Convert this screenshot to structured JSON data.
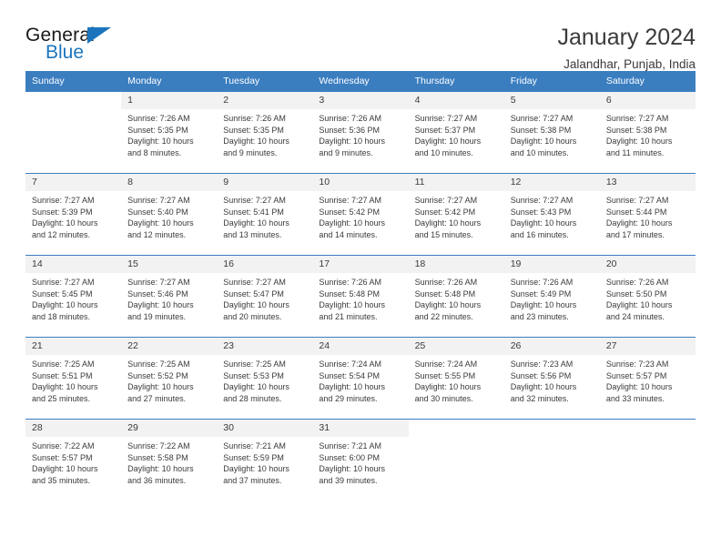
{
  "brand": {
    "name_part1": "General",
    "name_part2": "Blue",
    "logo_icon": "triangle-flag-icon"
  },
  "header": {
    "title": "January 2024",
    "subtitle": "Jalandhar, Punjab, India"
  },
  "colors": {
    "header_blue": "#3b7ec0",
    "brand_blue": "#1c75bc",
    "daynum_band": "#f2f2f2",
    "text": "#3a3a3a"
  },
  "weekday_headers": [
    "Sunday",
    "Monday",
    "Tuesday",
    "Wednesday",
    "Thursday",
    "Friday",
    "Saturday"
  ],
  "weeks": [
    [
      {
        "day": "",
        "sunrise": "",
        "sunset": "",
        "daylight1": "",
        "daylight2": ""
      },
      {
        "day": "1",
        "sunrise": "Sunrise: 7:26 AM",
        "sunset": "Sunset: 5:35 PM",
        "daylight1": "Daylight: 10 hours",
        "daylight2": "and 8 minutes."
      },
      {
        "day": "2",
        "sunrise": "Sunrise: 7:26 AM",
        "sunset": "Sunset: 5:35 PM",
        "daylight1": "Daylight: 10 hours",
        "daylight2": "and 9 minutes."
      },
      {
        "day": "3",
        "sunrise": "Sunrise: 7:26 AM",
        "sunset": "Sunset: 5:36 PM",
        "daylight1": "Daylight: 10 hours",
        "daylight2": "and 9 minutes."
      },
      {
        "day": "4",
        "sunrise": "Sunrise: 7:27 AM",
        "sunset": "Sunset: 5:37 PM",
        "daylight1": "Daylight: 10 hours",
        "daylight2": "and 10 minutes."
      },
      {
        "day": "5",
        "sunrise": "Sunrise: 7:27 AM",
        "sunset": "Sunset: 5:38 PM",
        "daylight1": "Daylight: 10 hours",
        "daylight2": "and 10 minutes."
      },
      {
        "day": "6",
        "sunrise": "Sunrise: 7:27 AM",
        "sunset": "Sunset: 5:38 PM",
        "daylight1": "Daylight: 10 hours",
        "daylight2": "and 11 minutes."
      }
    ],
    [
      {
        "day": "7",
        "sunrise": "Sunrise: 7:27 AM",
        "sunset": "Sunset: 5:39 PM",
        "daylight1": "Daylight: 10 hours",
        "daylight2": "and 12 minutes."
      },
      {
        "day": "8",
        "sunrise": "Sunrise: 7:27 AM",
        "sunset": "Sunset: 5:40 PM",
        "daylight1": "Daylight: 10 hours",
        "daylight2": "and 12 minutes."
      },
      {
        "day": "9",
        "sunrise": "Sunrise: 7:27 AM",
        "sunset": "Sunset: 5:41 PM",
        "daylight1": "Daylight: 10 hours",
        "daylight2": "and 13 minutes."
      },
      {
        "day": "10",
        "sunrise": "Sunrise: 7:27 AM",
        "sunset": "Sunset: 5:42 PM",
        "daylight1": "Daylight: 10 hours",
        "daylight2": "and 14 minutes."
      },
      {
        "day": "11",
        "sunrise": "Sunrise: 7:27 AM",
        "sunset": "Sunset: 5:42 PM",
        "daylight1": "Daylight: 10 hours",
        "daylight2": "and 15 minutes."
      },
      {
        "day": "12",
        "sunrise": "Sunrise: 7:27 AM",
        "sunset": "Sunset: 5:43 PM",
        "daylight1": "Daylight: 10 hours",
        "daylight2": "and 16 minutes."
      },
      {
        "day": "13",
        "sunrise": "Sunrise: 7:27 AM",
        "sunset": "Sunset: 5:44 PM",
        "daylight1": "Daylight: 10 hours",
        "daylight2": "and 17 minutes."
      }
    ],
    [
      {
        "day": "14",
        "sunrise": "Sunrise: 7:27 AM",
        "sunset": "Sunset: 5:45 PM",
        "daylight1": "Daylight: 10 hours",
        "daylight2": "and 18 minutes."
      },
      {
        "day": "15",
        "sunrise": "Sunrise: 7:27 AM",
        "sunset": "Sunset: 5:46 PM",
        "daylight1": "Daylight: 10 hours",
        "daylight2": "and 19 minutes."
      },
      {
        "day": "16",
        "sunrise": "Sunrise: 7:27 AM",
        "sunset": "Sunset: 5:47 PM",
        "daylight1": "Daylight: 10 hours",
        "daylight2": "and 20 minutes."
      },
      {
        "day": "17",
        "sunrise": "Sunrise: 7:26 AM",
        "sunset": "Sunset: 5:48 PM",
        "daylight1": "Daylight: 10 hours",
        "daylight2": "and 21 minutes."
      },
      {
        "day": "18",
        "sunrise": "Sunrise: 7:26 AM",
        "sunset": "Sunset: 5:48 PM",
        "daylight1": "Daylight: 10 hours",
        "daylight2": "and 22 minutes."
      },
      {
        "day": "19",
        "sunrise": "Sunrise: 7:26 AM",
        "sunset": "Sunset: 5:49 PM",
        "daylight1": "Daylight: 10 hours",
        "daylight2": "and 23 minutes."
      },
      {
        "day": "20",
        "sunrise": "Sunrise: 7:26 AM",
        "sunset": "Sunset: 5:50 PM",
        "daylight1": "Daylight: 10 hours",
        "daylight2": "and 24 minutes."
      }
    ],
    [
      {
        "day": "21",
        "sunrise": "Sunrise: 7:25 AM",
        "sunset": "Sunset: 5:51 PM",
        "daylight1": "Daylight: 10 hours",
        "daylight2": "and 25 minutes."
      },
      {
        "day": "22",
        "sunrise": "Sunrise: 7:25 AM",
        "sunset": "Sunset: 5:52 PM",
        "daylight1": "Daylight: 10 hours",
        "daylight2": "and 27 minutes."
      },
      {
        "day": "23",
        "sunrise": "Sunrise: 7:25 AM",
        "sunset": "Sunset: 5:53 PM",
        "daylight1": "Daylight: 10 hours",
        "daylight2": "and 28 minutes."
      },
      {
        "day": "24",
        "sunrise": "Sunrise: 7:24 AM",
        "sunset": "Sunset: 5:54 PM",
        "daylight1": "Daylight: 10 hours",
        "daylight2": "and 29 minutes."
      },
      {
        "day": "25",
        "sunrise": "Sunrise: 7:24 AM",
        "sunset": "Sunset: 5:55 PM",
        "daylight1": "Daylight: 10 hours",
        "daylight2": "and 30 minutes."
      },
      {
        "day": "26",
        "sunrise": "Sunrise: 7:23 AM",
        "sunset": "Sunset: 5:56 PM",
        "daylight1": "Daylight: 10 hours",
        "daylight2": "and 32 minutes."
      },
      {
        "day": "27",
        "sunrise": "Sunrise: 7:23 AM",
        "sunset": "Sunset: 5:57 PM",
        "daylight1": "Daylight: 10 hours",
        "daylight2": "and 33 minutes."
      }
    ],
    [
      {
        "day": "28",
        "sunrise": "Sunrise: 7:22 AM",
        "sunset": "Sunset: 5:57 PM",
        "daylight1": "Daylight: 10 hours",
        "daylight2": "and 35 minutes."
      },
      {
        "day": "29",
        "sunrise": "Sunrise: 7:22 AM",
        "sunset": "Sunset: 5:58 PM",
        "daylight1": "Daylight: 10 hours",
        "daylight2": "and 36 minutes."
      },
      {
        "day": "30",
        "sunrise": "Sunrise: 7:21 AM",
        "sunset": "Sunset: 5:59 PM",
        "daylight1": "Daylight: 10 hours",
        "daylight2": "and 37 minutes."
      },
      {
        "day": "31",
        "sunrise": "Sunrise: 7:21 AM",
        "sunset": "Sunset: 6:00 PM",
        "daylight1": "Daylight: 10 hours",
        "daylight2": "and 39 minutes."
      },
      {
        "day": "",
        "sunrise": "",
        "sunset": "",
        "daylight1": "",
        "daylight2": ""
      },
      {
        "day": "",
        "sunrise": "",
        "sunset": "",
        "daylight1": "",
        "daylight2": ""
      },
      {
        "day": "",
        "sunrise": "",
        "sunset": "",
        "daylight1": "",
        "daylight2": ""
      }
    ]
  ]
}
